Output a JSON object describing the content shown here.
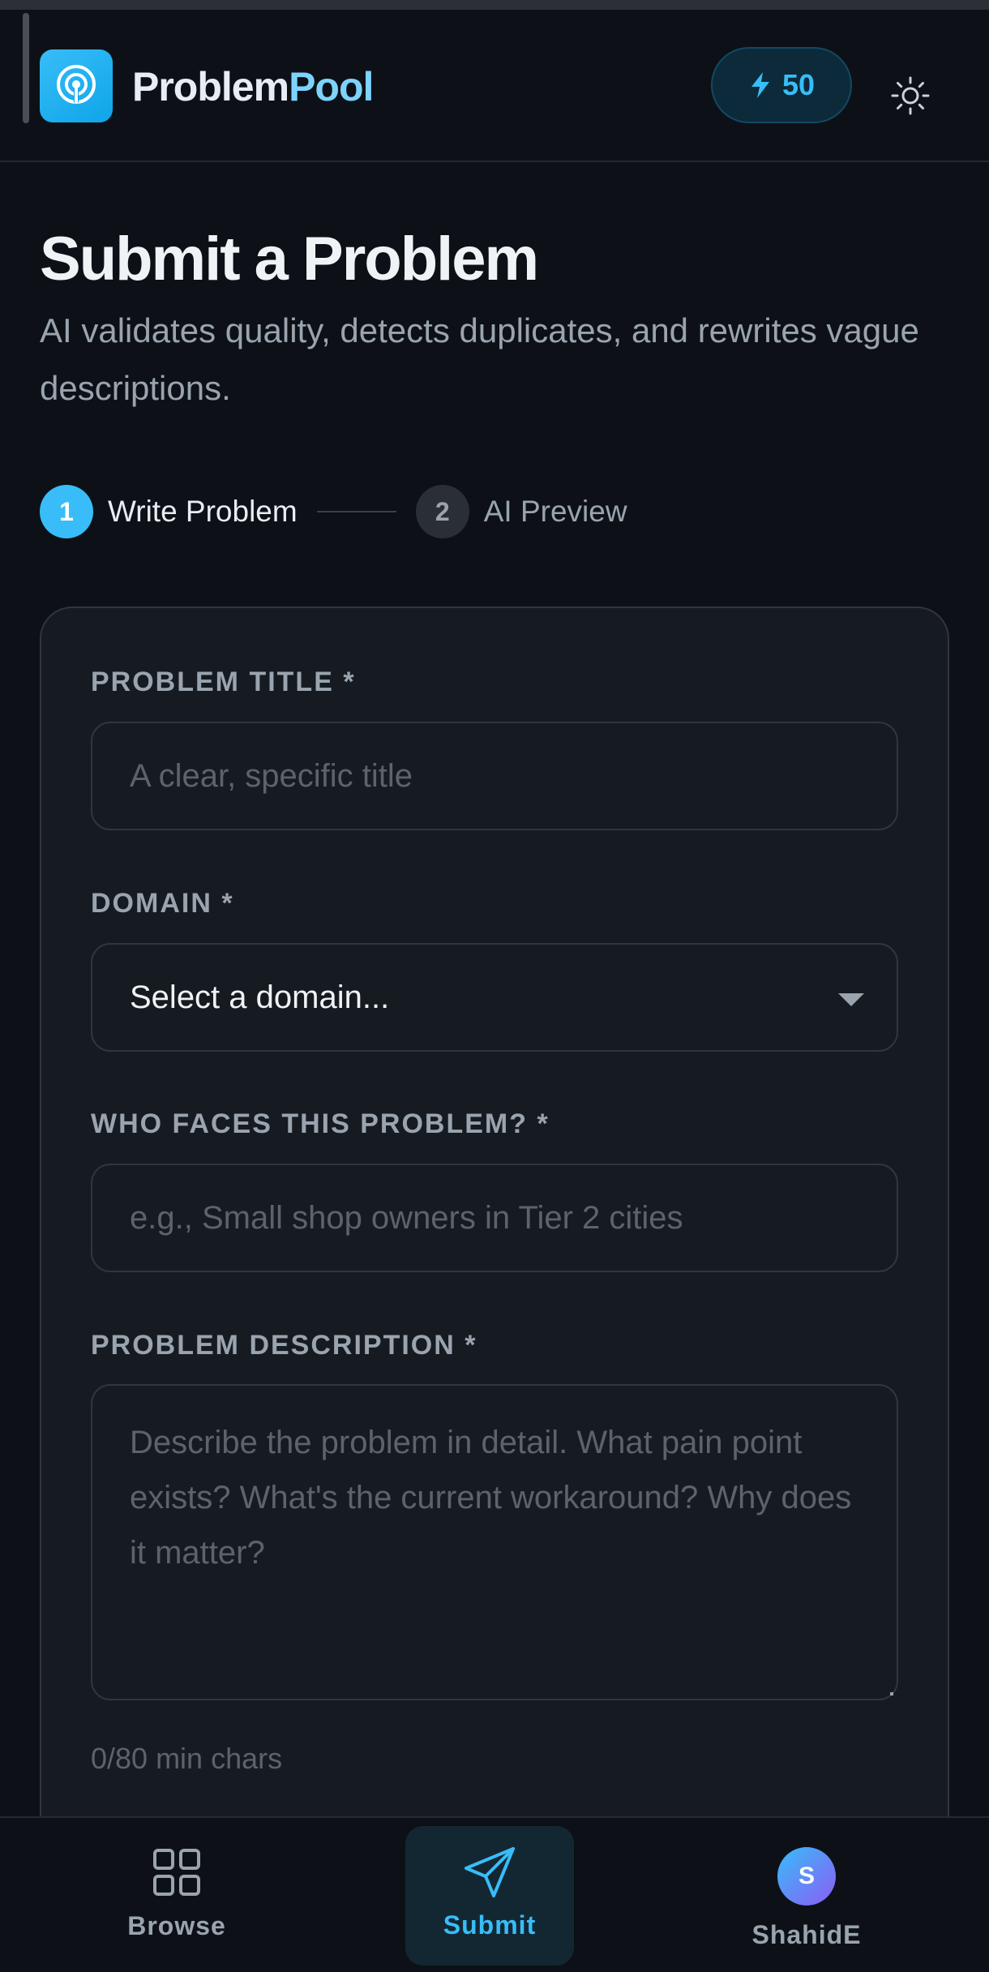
{
  "header": {
    "brand_part1": "Problem",
    "brand_part2": "Pool",
    "points": "50",
    "icons": {
      "logo": "podcast-icon",
      "points": "bolt-icon",
      "theme": "sun-icon"
    }
  },
  "page": {
    "title": "Submit a Problem",
    "subtitle": "AI validates quality, detects duplicates, and rewrites vague descriptions."
  },
  "steps": [
    {
      "number": "1",
      "label": "Write Problem",
      "active": true
    },
    {
      "number": "2",
      "label": "AI Preview",
      "active": false
    }
  ],
  "form": {
    "title": {
      "label": "PROBLEM TITLE *",
      "placeholder": "A clear, specific title",
      "value": ""
    },
    "domain": {
      "label": "DOMAIN *",
      "selected": "Select a domain..."
    },
    "audience": {
      "label": "WHO FACES THIS PROBLEM? *",
      "placeholder": "e.g., Small shop owners in Tier 2 cities",
      "value": ""
    },
    "description": {
      "label": "PROBLEM DESCRIPTION *",
      "placeholder": "Describe the problem in detail. What pain point exists? What's the current workaround? Why does it matter?",
      "value": ""
    },
    "char_count": "0/80 min chars"
  },
  "bottom_nav": {
    "browse": "Browse",
    "submit": "Submit",
    "profile_initial": "S",
    "profile": "ShahidE"
  },
  "colors": {
    "background": "#0d1117",
    "card": "#161b22",
    "accent": "#38bdf8",
    "border": "#30363d",
    "muted_text": "#9aa4ae"
  }
}
